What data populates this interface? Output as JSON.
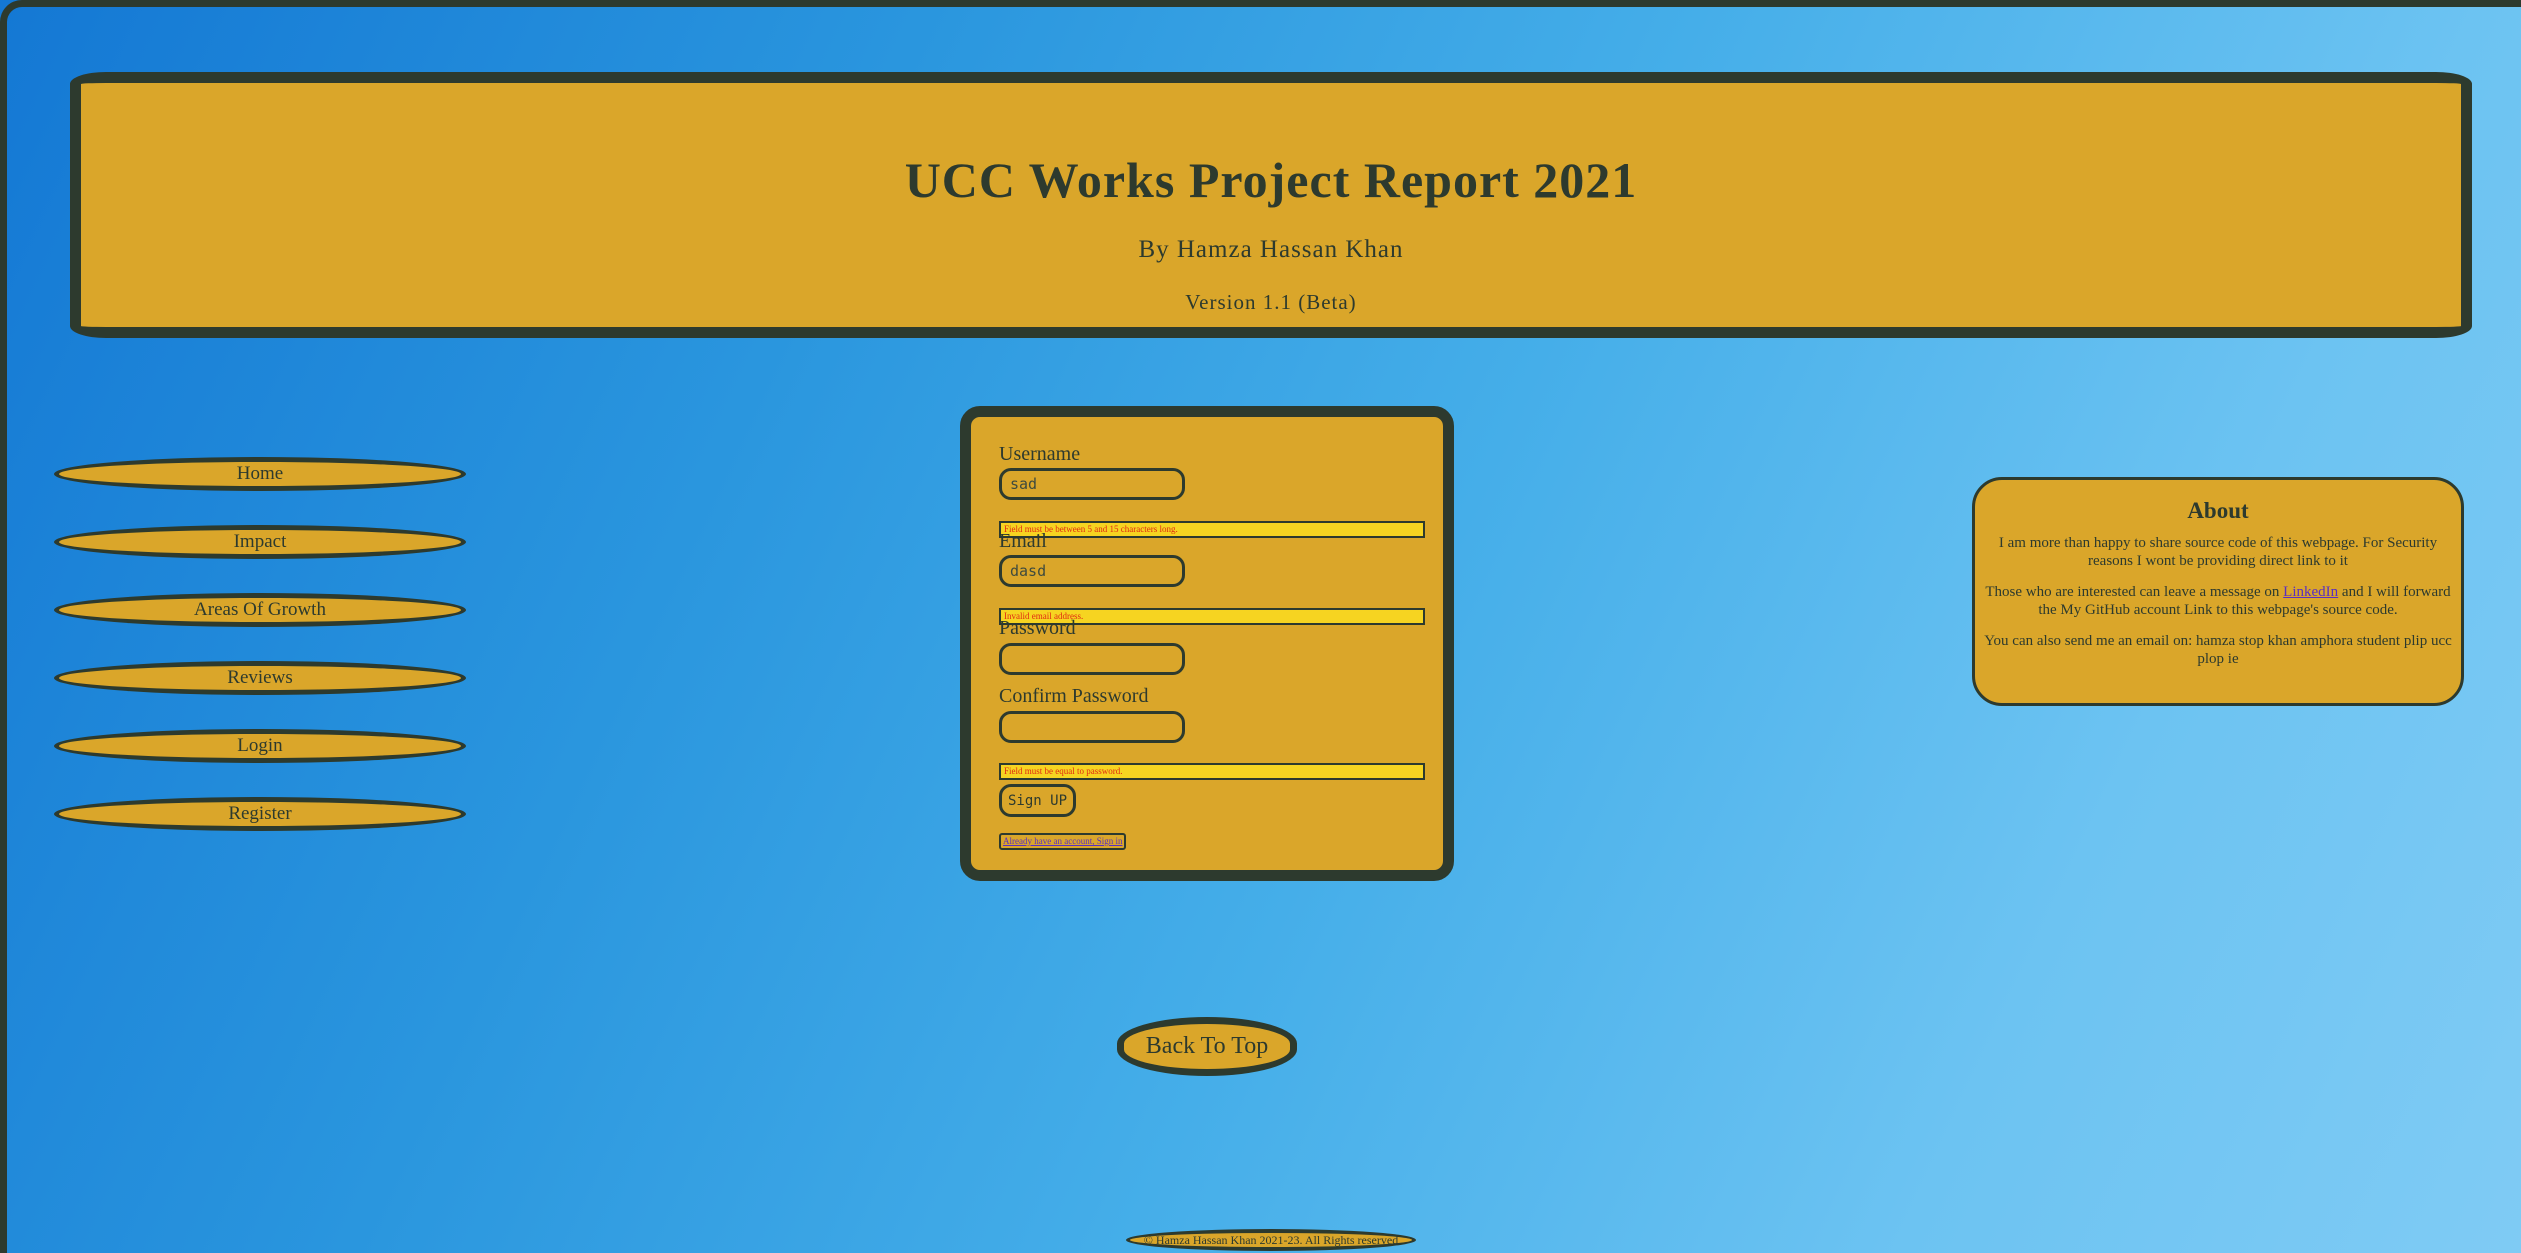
{
  "header": {
    "title": "UCC Works Project Report 2021",
    "author": "By Hamza Hassan Khan",
    "version": "Version 1.1 (Beta)"
  },
  "nav": {
    "home": "Home",
    "impact": "Impact",
    "areas": "Areas Of Growth",
    "reviews": "Reviews",
    "login": "Login",
    "register": "Register"
  },
  "form": {
    "username_label": "Username",
    "username_value": "sad",
    "username_error": "Field must be between 5 and 15 characters long.",
    "email_label": "Email",
    "email_value": "dasd",
    "email_error": "Invalid email address.",
    "password_label": "Password",
    "password_value": "",
    "confirm_label": "Confirm Password",
    "confirm_value": "",
    "confirm_error": "Field must be equal to password.",
    "signup_label": "Sign UP",
    "signin_link": "Already have an account, Sign in"
  },
  "about": {
    "title": "About",
    "p1": "I am more than happy to share source code of this webpage. For Security reasons I wont be providing direct link to it",
    "p2_before": "Those who are interested can leave a message on ",
    "p2_link": "LinkedIn",
    "p2_after": " and I will forward the My GitHub account Link to this webpage's source code.",
    "p3": "You can also send me an email on: hamza stop khan amphora student plip ucc plop ie"
  },
  "back_to_top": "Back To Top",
  "footer": "© Hamza Hassan Khan 2021-23. All Rights reserved",
  "colors": {
    "gold": "#daa62a",
    "dark": "#2d3a2e",
    "error_bg": "#f6d421",
    "error_text": "#e02a12",
    "link": "#5a2fc0"
  }
}
